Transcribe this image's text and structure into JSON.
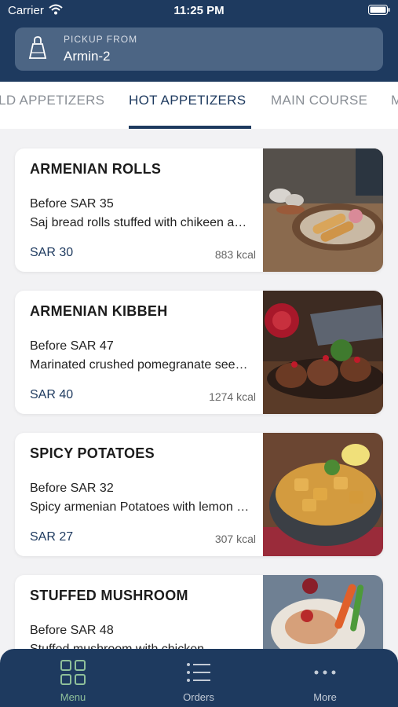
{
  "status_bar": {
    "carrier": "Carrier",
    "time": "11:25 PM"
  },
  "pickup": {
    "label": "PICKUP FROM",
    "value": "Armin-2"
  },
  "tabs": [
    {
      "label": "COLD APPETIZERS",
      "active": false
    },
    {
      "label": "HOT APPETIZERS",
      "active": true
    },
    {
      "label": "MAIN COURSE",
      "active": false
    },
    {
      "label": "M",
      "active": false
    }
  ],
  "items": [
    {
      "name": "ARMENIAN ROLLS",
      "before": "Before SAR 35",
      "description": "Saj bread rolls stuffed with chikeen and cheese",
      "price": "SAR 30",
      "kcal": "883 kcal"
    },
    {
      "name": "ARMENIAN KIBBEH",
      "before": "Before SAR 47",
      "description": "Marinated crushed  pomegranate seeds and meat",
      "price": "SAR 40",
      "kcal": "1274 kcal"
    },
    {
      "name": "SPICY POTATOES",
      "before": "Before SAR 32",
      "description": "Spicy armenian Potatoes with lemon and herbs",
      "price": "SAR 27",
      "kcal": "307 kcal"
    },
    {
      "name": "STUFFED MUSHROOM",
      "before": "Before SAR 48",
      "description": "Stuffed mushroom with chicken",
      "price": "",
      "kcal": ""
    }
  ],
  "bottom_nav": [
    {
      "label": "Menu",
      "icon": "grid-icon",
      "active": true
    },
    {
      "label": "Orders",
      "icon": "list-icon",
      "active": false
    },
    {
      "label": "More",
      "icon": "more-icon",
      "active": false
    }
  ],
  "colors": {
    "primary": "#1e3a5f",
    "accent": "#8fc09a",
    "background": "#f2f2f4"
  }
}
